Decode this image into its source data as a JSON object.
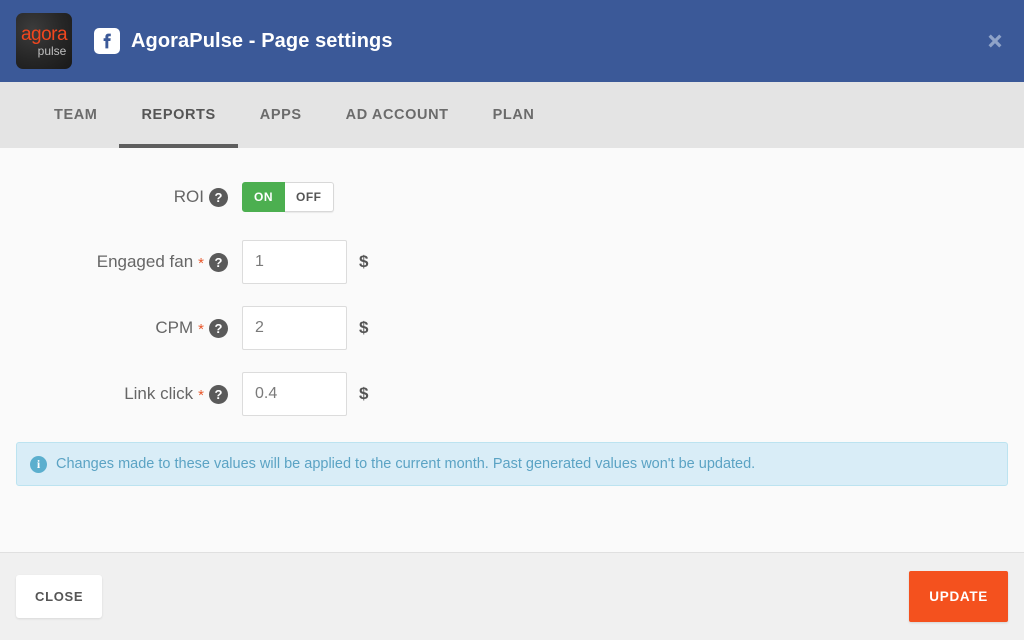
{
  "header": {
    "logo_top": "agora",
    "logo_bottom": "pulse",
    "network_icon": "facebook-icon",
    "title": "AgoraPulse - Page settings",
    "close_icon": "close-icon",
    "background_color": "#3b5998"
  },
  "tabs": [
    {
      "label": "TEAM",
      "active": false
    },
    {
      "label": "REPORTS",
      "active": true
    },
    {
      "label": "APPS",
      "active": false
    },
    {
      "label": "AD ACCOUNT",
      "active": false
    },
    {
      "label": "PLAN",
      "active": false
    }
  ],
  "form": {
    "roi": {
      "label": "ROI",
      "help_icon": "question-mark-icon",
      "on_label": "ON",
      "off_label": "OFF",
      "state": "ON",
      "on_color": "#4caf50"
    },
    "fields": [
      {
        "label": "Engaged fan",
        "required_marker": "*",
        "help_icon": "question-mark-icon",
        "value": "1",
        "placeholder": "",
        "currency": "$"
      },
      {
        "label": "CPM",
        "required_marker": "*",
        "help_icon": "question-mark-icon",
        "value": "2",
        "placeholder": "",
        "currency": "$"
      },
      {
        "label": "Link click",
        "required_marker": "*",
        "help_icon": "question-mark-icon",
        "value": "0.4",
        "placeholder": "",
        "currency": "$"
      }
    ]
  },
  "banner": {
    "icon": "info-icon",
    "text": "Changes made to these values will be applied to the current month. Past generated values won't be updated.",
    "background_color": "#d9edf7",
    "text_color": "#5ba3c4"
  },
  "footer": {
    "close_label": "CLOSE",
    "update_label": "UPDATE",
    "update_color": "#f4511e"
  }
}
